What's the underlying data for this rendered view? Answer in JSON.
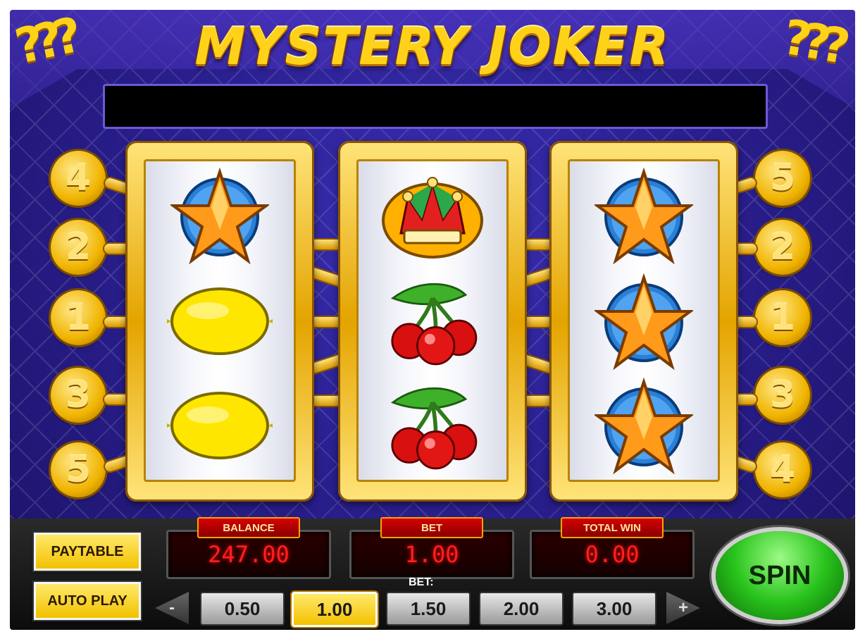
{
  "game": {
    "title": "MYSTERY JOKER",
    "decor": {
      "left": "???",
      "right": "???"
    }
  },
  "paylines": {
    "left": [
      "4",
      "2",
      "1",
      "3",
      "5"
    ],
    "right": [
      "5",
      "2",
      "1",
      "3",
      "4"
    ]
  },
  "reels": [
    [
      "star",
      "lemon",
      "lemon"
    ],
    [
      "joker",
      "cherries",
      "cherries"
    ],
    [
      "star",
      "star",
      "star"
    ]
  ],
  "buttons": {
    "paytable": "PAYTABLE",
    "autoplay": "AUTO PLAY",
    "spin": "SPIN",
    "bet_minus": "-",
    "bet_plus": "+"
  },
  "meters": {
    "balance_label": "BALANCE",
    "balance_value": "247.00",
    "bet_label": "BET",
    "bet_value": "1.00",
    "totalwin_label": "TOTAL WIN",
    "totalwin_value": "0.00"
  },
  "bet_selector": {
    "label": "BET:",
    "options": [
      "0.50",
      "1.00",
      "1.50",
      "2.00",
      "3.00"
    ],
    "selected": "1.00"
  }
}
